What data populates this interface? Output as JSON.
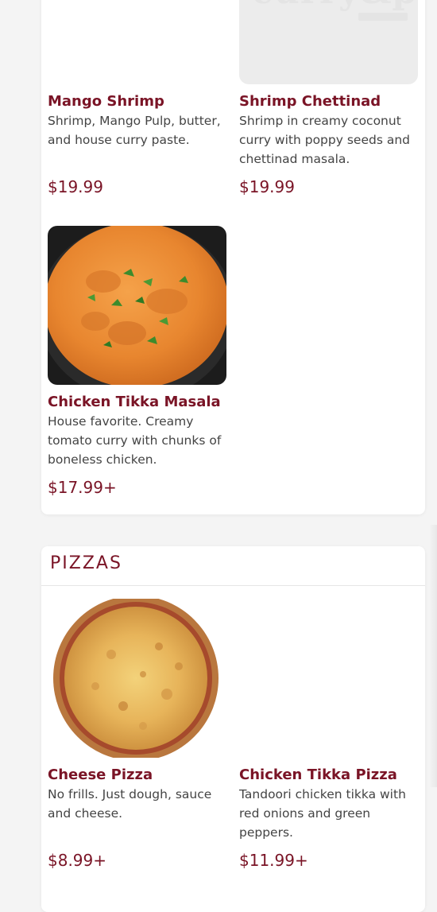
{
  "curries": {
    "items": [
      {
        "name": "Mango Shrimp",
        "desc": "Shrimp, Mango Pulp, butter, and house curry paste.",
        "price": "$19.99"
      },
      {
        "name": "Shrimp Chettinad",
        "desc": "Shrimp in creamy coconut curry with poppy seeds and chettinad masala.",
        "price": "$19.99",
        "image_logo_text": "curry&pie"
      },
      {
        "name": "Chicken Tikka Masala",
        "desc": "House favorite. Creamy tomato curry with chunks of boneless chicken.",
        "price": "$17.99+"
      }
    ]
  },
  "pizzas": {
    "title": "PIZZAS",
    "items": [
      {
        "name": "Cheese Pizza",
        "desc": "No frills. Just dough, sauce and cheese.",
        "price": "$8.99+"
      },
      {
        "name": "Chicken Tikka Pizza",
        "desc": "Tandoori chicken tikka with red onions and green peppers.",
        "price": "$11.99+"
      }
    ]
  },
  "colors": {
    "accent": "#7a1426",
    "text": "#444444",
    "background": "#f4f4f4",
    "card": "#ffffff"
  }
}
